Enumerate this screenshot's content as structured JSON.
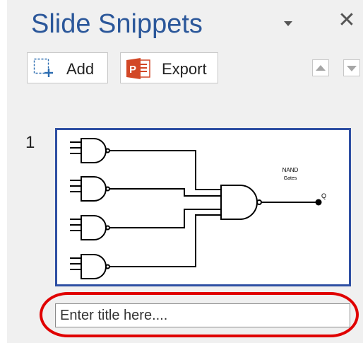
{
  "pane": {
    "title": "Slide Snippets",
    "menu_icon": "dropdown-triangle-icon",
    "close_glyph": "✕"
  },
  "toolbar": {
    "add_label": "Add",
    "export_label": "Export"
  },
  "slides": [
    {
      "number": "1",
      "thumbnail_text": {
        "heading_line1": "NAND",
        "heading_line2": "Gates",
        "output_label": "Q"
      },
      "title_placeholder": "Enter title here...."
    }
  ],
  "colors": {
    "title": "#2b579a",
    "thumbnail_border": "#2e4fa3",
    "highlight": "#e00000",
    "export_icon": "#d24726"
  }
}
